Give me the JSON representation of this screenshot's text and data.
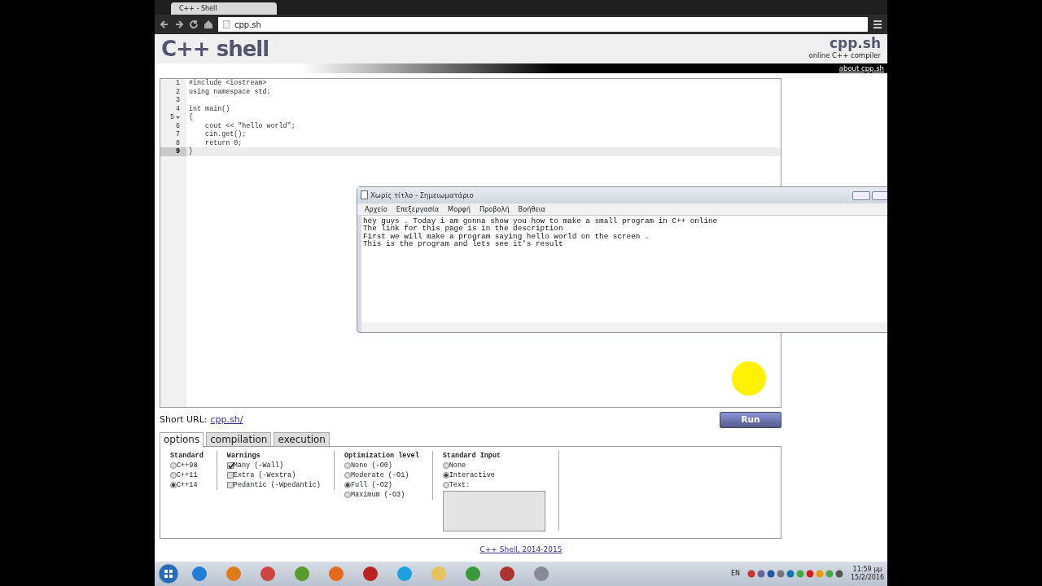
{
  "browser": {
    "tab_title": "C++ - Shell",
    "address": "cpp.sh"
  },
  "header": {
    "logo": "C++ shell",
    "brand": "cpp.sh",
    "tagline": "online C++ compiler",
    "about": "about cpp.sh"
  },
  "editor": {
    "lines": [
      {
        "number": "1",
        "code": "#include <iostream>",
        "active": false
      },
      {
        "number": "2",
        "code": "using namespace std;",
        "active": false
      },
      {
        "number": "3",
        "active": false
      },
      {
        "number": "4",
        "code": "int main()",
        "active": false
      },
      {
        "number": "5",
        "code": "{",
        "active": false,
        "fold": true
      },
      {
        "number": "6",
        "code": "    cout << \"hello world\";",
        "active": false
      },
      {
        "number": "7",
        "code": "    cin.get();",
        "active": false
      },
      {
        "number": "8",
        "code": "    return 0;",
        "active": false
      },
      {
        "number": "9",
        "code": "}",
        "active": true
      }
    ]
  },
  "notepad": {
    "title": "Χωρίς τίτλο - Σημειωματάριο",
    "menu": [
      "Αρχείο",
      "Επεξεργασία",
      "Μορφή",
      "Προβολή",
      "Βοήθεια"
    ],
    "lines": [
      "hey guys . Today i am gonna show you how to make a small program in C++ online",
      "The link for this page is in the description",
      "First we will make a program saying hello world on the screen .",
      "This is the program and lets see it's result"
    ]
  },
  "short_url": {
    "label": "Short URL:",
    "link": "cpp.sh/"
  },
  "run_button": "Run",
  "tabs": [
    {
      "label": "options",
      "selected": true
    },
    {
      "label": "compilation",
      "selected": false
    },
    {
      "label": "execution",
      "selected": false
    }
  ],
  "option_groups": [
    {
      "title": "Standard",
      "kind": "radio",
      "options": [
        {
          "label": "C++98",
          "selected": false
        },
        {
          "label": "C++11",
          "selected": false
        },
        {
          "label": "C++14",
          "selected": true
        }
      ]
    },
    {
      "title": "Warnings",
      "kind": "checkbox",
      "options": [
        {
          "label": "Many (-Wall)",
          "checked": true
        },
        {
          "label": "Extra (-Wextra)",
          "checked": false
        },
        {
          "label": "Pedantic (-Wpedantic)",
          "checked": false
        }
      ]
    },
    {
      "title": "Optimization level",
      "kind": "radio",
      "options": [
        {
          "label": "None (-O0)",
          "selected": false
        },
        {
          "label": "Moderate (-O1)",
          "selected": false
        },
        {
          "label": "Full (-O2)",
          "selected": true
        },
        {
          "label": "Maximum (-O3)",
          "selected": false
        }
      ]
    },
    {
      "title": "Standard Input",
      "kind": "radio",
      "text_area": true,
      "options": [
        {
          "label": "None",
          "selected": false
        },
        {
          "label": "Interactive",
          "selected": true
        },
        {
          "label": "Text:",
          "selected": false
        }
      ]
    }
  ],
  "footer": "C++ Shell, 2014-2015",
  "taskbar": {
    "language": "EN",
    "time": "11:59 μμ",
    "date": "15/2/2016"
  }
}
